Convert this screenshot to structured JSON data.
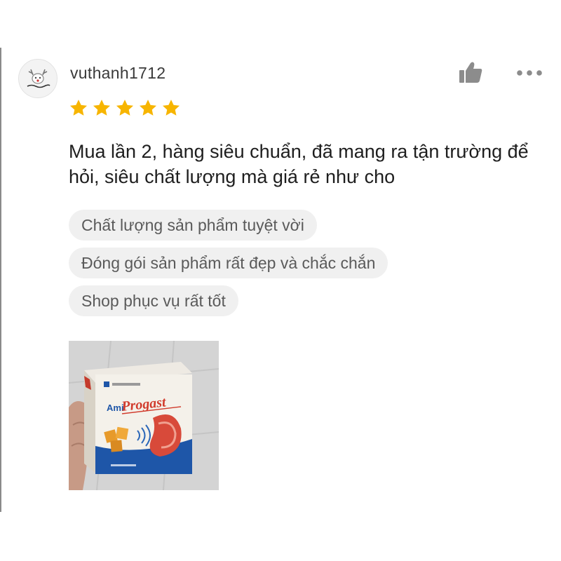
{
  "review": {
    "username": "vuthanh1712",
    "avatar_icon": "user-avatar-icon",
    "rating": 5,
    "rating_max": 5,
    "star_color": "#f7b500",
    "like_icon": "thumbs-up-icon",
    "more_icon": "more-horizontal-icon",
    "text": "Mua lần 2, hàng siêu chuẩn, đã mang ra tận trường để hỏi, siêu chất lượng mà giá rẻ như cho",
    "tags": [
      "Chất lượng sản phẩm tuyệt vời",
      "Đóng gói sản phẩm rất đẹp và chắc chắn",
      "Shop phục vụ rất tốt"
    ],
    "photo": {
      "product_brand_small": "Ami",
      "product_brand_large": "Progast"
    }
  }
}
